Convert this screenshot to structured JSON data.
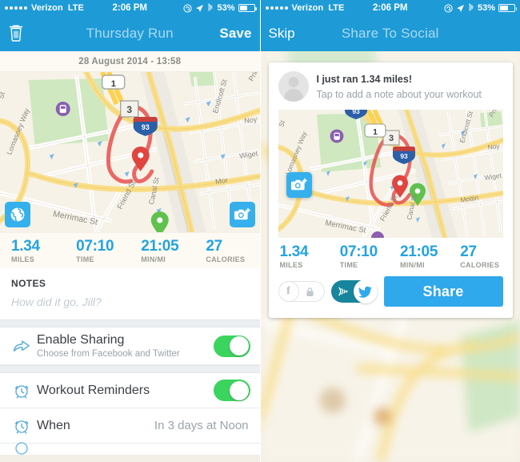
{
  "status_bar": {
    "signal_dots": 5,
    "carrier": "Verizon",
    "network": "LTE",
    "time": "2:06 PM",
    "battery_percent": "53%",
    "icons": [
      "rotation-lock-icon",
      "location-arrow-icon",
      "bluetooth-icon",
      "battery-icon"
    ]
  },
  "left_screen": {
    "nav": {
      "delete_icon": "trash-icon",
      "title": "Thursday Run",
      "save_label": "Save"
    },
    "date_label": "28 August 2014 - 13:58",
    "map": {
      "globe_icon": "globe-icon",
      "camera_icon": "camera-plus-icon",
      "streets": [
        "Merrimac St",
        "Friend St",
        "Canal St",
        "Endicott St",
        "Lomasney Way",
        "Wiget",
        "Noy",
        "Prin",
        "Mor"
      ],
      "highway_shield": "93",
      "route_markers": [
        "1",
        "3"
      ],
      "start_pin": "green-pin",
      "end_pin": "red-pin"
    },
    "stats": [
      {
        "value": "1.34",
        "label": "MILES"
      },
      {
        "value": "07:10",
        "label": "TIME"
      },
      {
        "value": "21:05",
        "label": "MIN/MI"
      },
      {
        "value": "27",
        "label": "CALORIES"
      }
    ],
    "notes": {
      "header": "NOTES",
      "placeholder": "How did it go, Jill?",
      "value": ""
    },
    "rows": [
      {
        "icon": "share-arrow-icon",
        "title": "Enable Sharing",
        "subtitle": "Choose from Facebook and Twitter",
        "toggle": "on"
      },
      {
        "icon": "alarm-clock-icon",
        "title": "Workout Reminders",
        "subtitle": "",
        "toggle": "on"
      },
      {
        "icon": "alarm-clock-icon",
        "title": "When",
        "subtitle": "",
        "value": "In 3 days at Noon"
      }
    ]
  },
  "right_screen": {
    "nav": {
      "skip_label": "Skip",
      "title": "Share To Social"
    },
    "card": {
      "avatar": "user-avatar",
      "title": "I just ran 1.34 miles!",
      "subtitle": "Tap to add a note about your workout",
      "camera_icon": "camera-plus-icon",
      "stats": [
        {
          "value": "1.34",
          "label": "MILES"
        },
        {
          "value": "07:10",
          "label": "TIME"
        },
        {
          "value": "21:05",
          "label": "MIN/MI"
        },
        {
          "value": "27",
          "label": "CALORIES"
        }
      ],
      "facebook_toggle": {
        "state": "off",
        "glyph": "f",
        "lock_icon": "lock-icon"
      },
      "twitter_toggle": {
        "state": "on",
        "icon": "twitter-bird-icon",
        "broadcast_icon": "broadcast-waves-icon"
      },
      "share_label": "Share"
    }
  },
  "colors": {
    "nav_blue": "#1e9bd7",
    "accent_blue": "#24a3e0",
    "share_button_blue": "#30a8ec",
    "toggle_green": "#3ad45f",
    "twitter_teal": "#17869c",
    "route_red": "#e8514f",
    "map_bg": "#f7f3e8"
  }
}
